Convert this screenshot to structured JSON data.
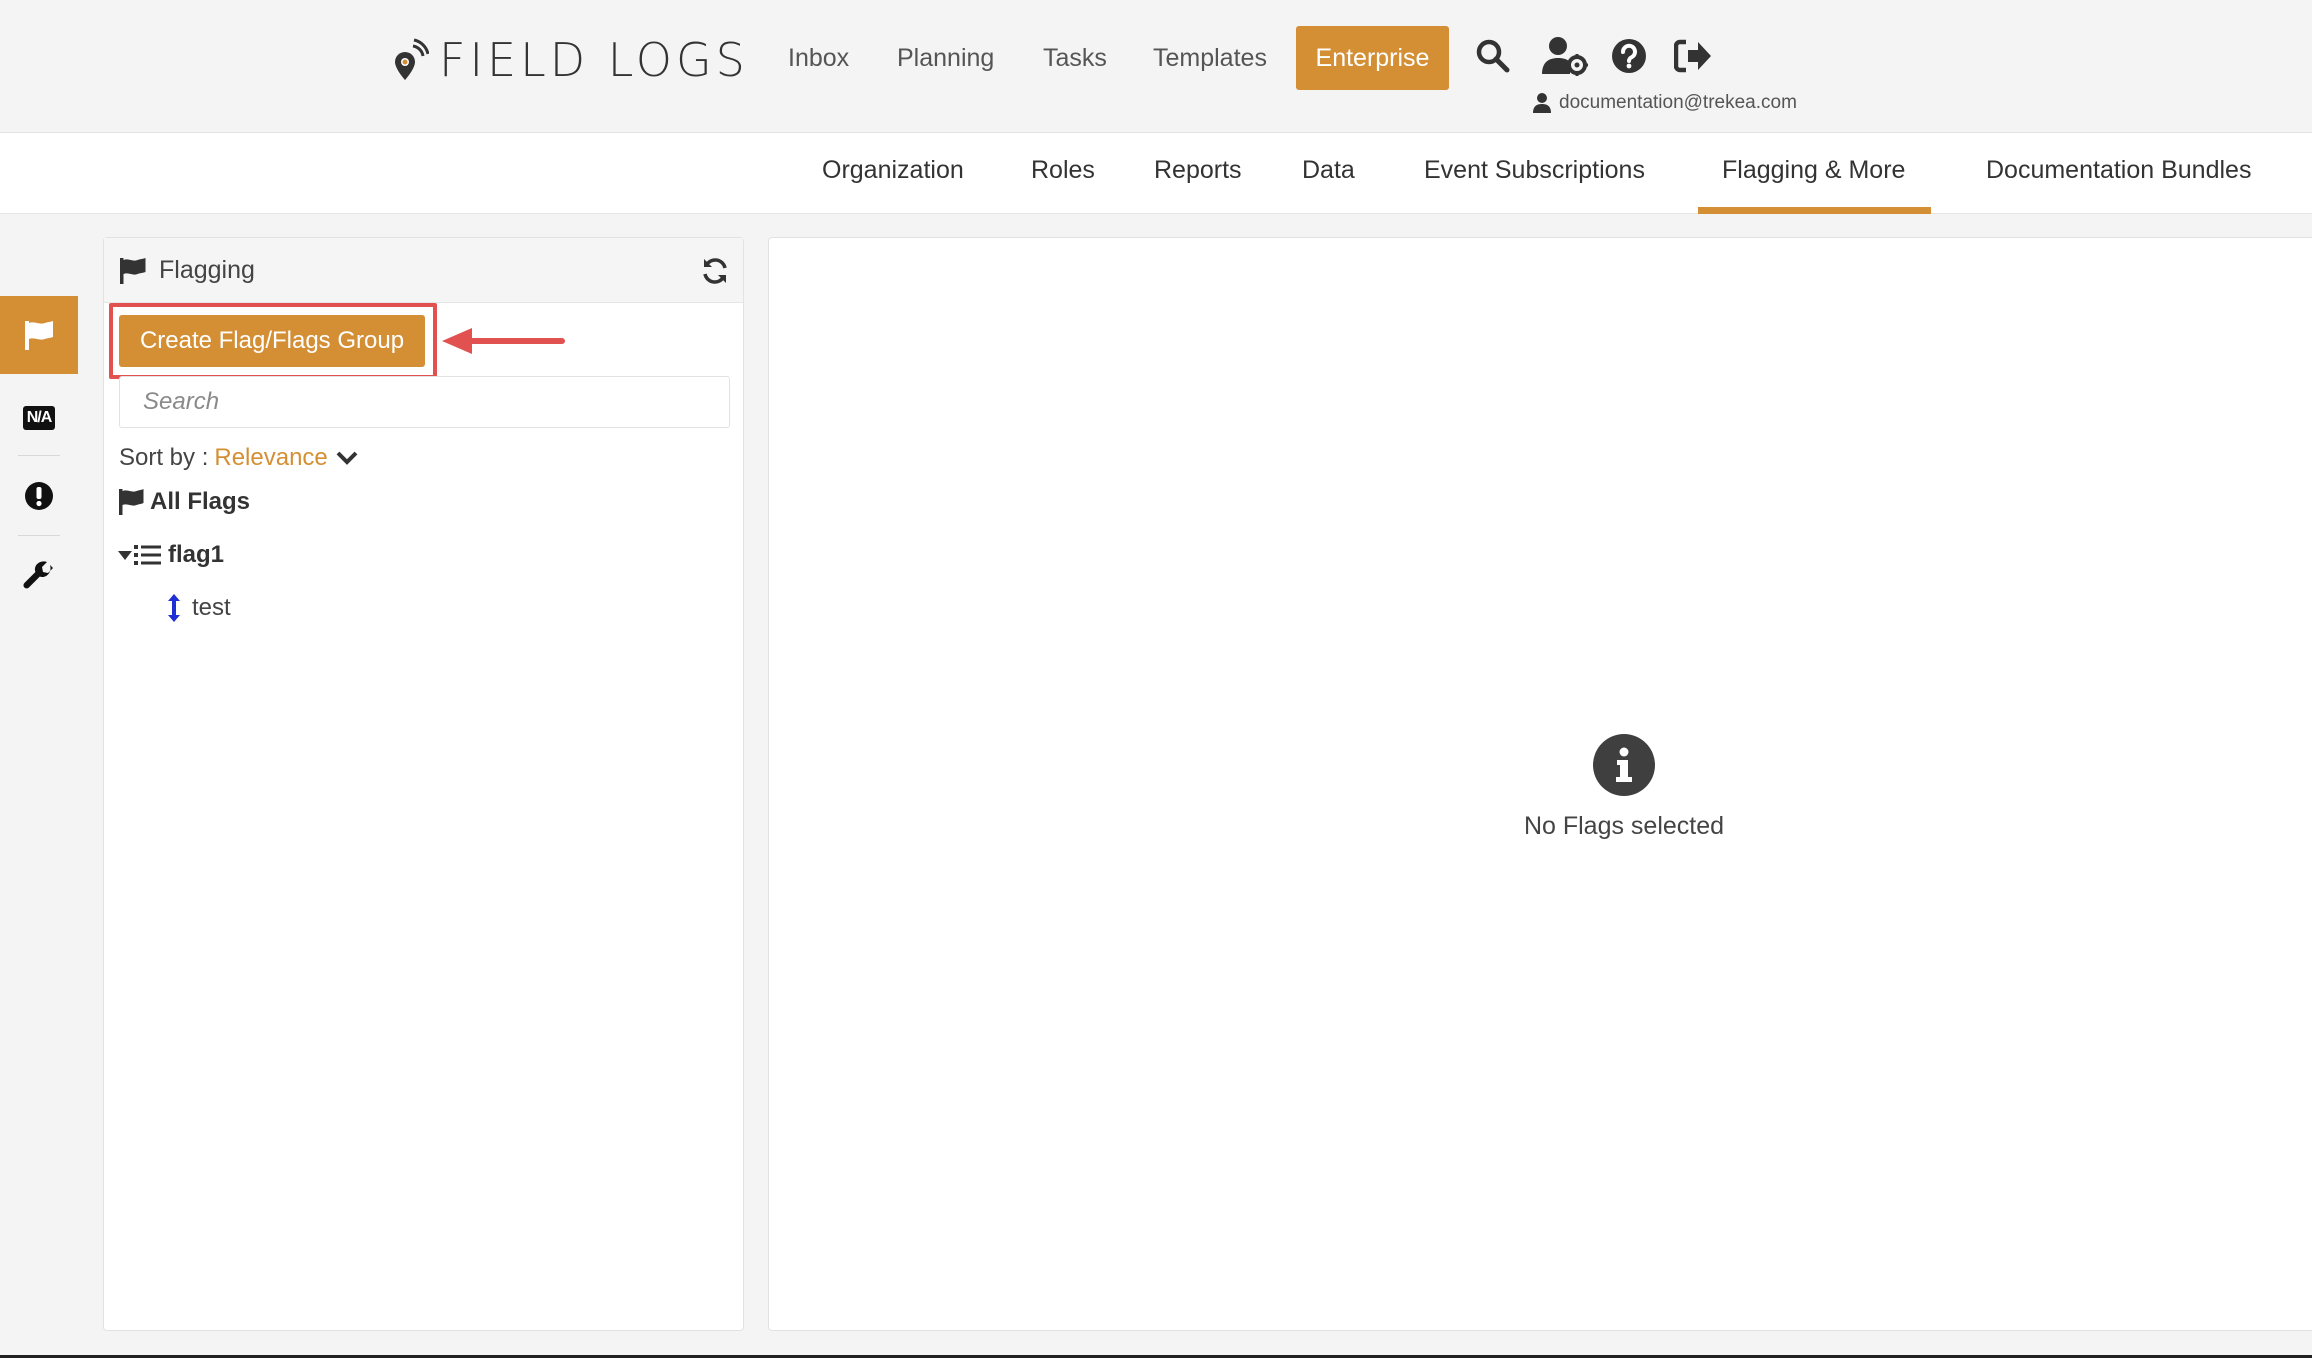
{
  "app": {
    "brand": "FIELD LOGS",
    "brand_color": "#d48f35"
  },
  "header": {
    "nav": [
      {
        "label": "Inbox"
      },
      {
        "label": "Planning"
      },
      {
        "label": "Tasks"
      },
      {
        "label": "Templates"
      },
      {
        "label": "Enterprise",
        "active": true
      }
    ],
    "icons": [
      "search-icon",
      "user-settings-icon",
      "help-icon",
      "sign-out-icon"
    ],
    "user_email": "documentation@trekea.com"
  },
  "subnav": {
    "tabs": [
      {
        "label": "Organization"
      },
      {
        "label": "Roles"
      },
      {
        "label": "Reports"
      },
      {
        "label": "Data"
      },
      {
        "label": "Event Subscriptions"
      },
      {
        "label": "Flagging & More",
        "active": true
      },
      {
        "label": "Documentation Bundles"
      }
    ]
  },
  "rail": {
    "items": [
      {
        "icon": "flag-icon",
        "active": true
      },
      {
        "icon": "na-icon",
        "text": "N/A"
      },
      {
        "icon": "exclamation-icon"
      },
      {
        "icon": "wrench-icon"
      }
    ]
  },
  "flagging": {
    "title": "Flagging",
    "create_button": "Create Flag/Flags Group",
    "search_placeholder": "Search",
    "sort_label": "Sort by :",
    "sort_value": "Relevance",
    "tree": {
      "all_flags": "All Flags",
      "group": "flag1",
      "leaf": "test"
    }
  },
  "details": {
    "empty_message": "No Flags selected"
  },
  "colors": {
    "accent": "#d48f35",
    "highlight": "#e0514f",
    "leaf_icon": "#1f2fd6"
  }
}
